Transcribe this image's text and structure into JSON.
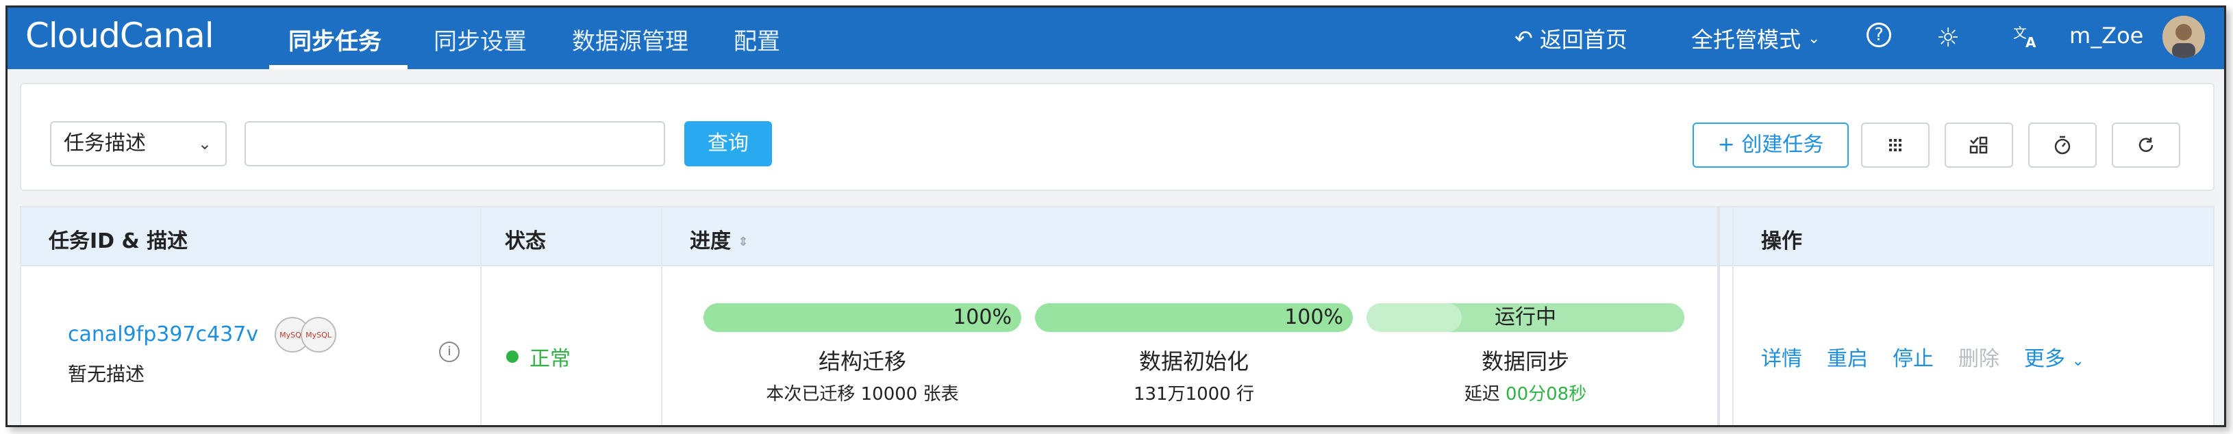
{
  "app": {
    "logo": "CloudCanal"
  },
  "nav": {
    "tabs": [
      "同步任务",
      "同步设置",
      "数据源管理",
      "配置"
    ],
    "home": "返回首页",
    "mode": "全托管模式",
    "help_icon": "?",
    "username": "m_Zoe"
  },
  "filter": {
    "select_value": "任务描述",
    "input_value": "",
    "query_label": "查询",
    "create_label": "+ 创建任务"
  },
  "table": {
    "headers": [
      "任务ID & 描述",
      "状态",
      "进度",
      "操作"
    ],
    "row": {
      "task_id": "canal9fp397c437v",
      "desc": "暂无描述",
      "db_tags": [
        "MySQL",
        "MySQL"
      ],
      "status": "正常",
      "stages": [
        {
          "label": "100%",
          "progress": 1.0,
          "title": "结构迁移",
          "sub": "本次已迁移 10000 张表"
        },
        {
          "label": "100%",
          "progress": 1.0,
          "title": "数据初始化",
          "sub": "131万1000 行"
        },
        {
          "label": "运行中",
          "progress": 0.3,
          "title": "数据同步",
          "sub_prefix": "延迟 ",
          "sub_value": "00分08秒"
        }
      ],
      "ops": [
        "详情",
        "重启",
        "停止",
        "删除",
        "更多"
      ]
    }
  },
  "colors": {
    "nav_bg": "#1c6fc2",
    "accent": "#1e8fdc",
    "ok": "#2fb344"
  }
}
